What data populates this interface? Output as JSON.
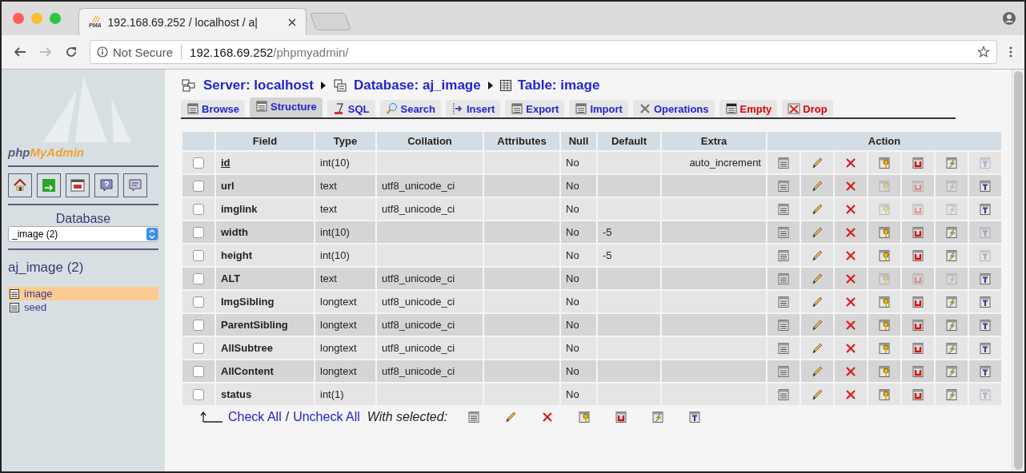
{
  "browser": {
    "tab": {
      "icon_text": "PMA",
      "title": "192.168.69.252 / localhost / a|"
    },
    "security": "Not Secure",
    "url_host": "192.168.69.252",
    "url_path": "/phpmyadmin/"
  },
  "sidebar": {
    "logo": {
      "part_1": "php",
      "part_2": "MyAdmin"
    },
    "database_label": "Database",
    "database_select": "_image (2)",
    "database_heading": "aj_image (2)",
    "tables": [
      {
        "name": "image",
        "selected": true
      },
      {
        "name": "seed",
        "selected": false
      }
    ]
  },
  "breadcrumb": [
    {
      "kind": "server",
      "label": "Server: localhost"
    },
    {
      "kind": "database",
      "label": "Database: aj_image"
    },
    {
      "kind": "table",
      "label": "Table: image"
    }
  ],
  "tabs": [
    {
      "kind": "browse",
      "label": "Browse",
      "selected": false,
      "danger": false
    },
    {
      "kind": "structure",
      "label": "Structure",
      "selected": true,
      "danger": false
    },
    {
      "kind": "sql",
      "label": "SQL",
      "selected": false,
      "danger": false
    },
    {
      "kind": "search",
      "label": "Search",
      "selected": false,
      "danger": false
    },
    {
      "kind": "insert",
      "label": "Insert",
      "selected": false,
      "danger": false
    },
    {
      "kind": "export",
      "label": "Export",
      "selected": false,
      "danger": false
    },
    {
      "kind": "import",
      "label": "Import",
      "selected": false,
      "danger": false
    },
    {
      "kind": "operations",
      "label": "Operations",
      "selected": false,
      "danger": false
    },
    {
      "kind": "empty",
      "label": "Empty",
      "selected": false,
      "danger": true
    },
    {
      "kind": "drop",
      "label": "Drop",
      "selected": false,
      "danger": true
    }
  ],
  "table": {
    "columns": [
      "Field",
      "Type",
      "Collation",
      "Attributes",
      "Null",
      "Default",
      "Extra",
      "Action"
    ],
    "rows": [
      {
        "field": "id",
        "primary": true,
        "checked": false,
        "type": "int(10)",
        "collation": "",
        "null": "No",
        "default": "",
        "extra": "auto_increment",
        "disabled": [
          false,
          false,
          false,
          false,
          false,
          false,
          true
        ]
      },
      {
        "field": "url",
        "primary": false,
        "checked": false,
        "type": "text",
        "collation": "utf8_unicode_ci",
        "null": "No",
        "default": "",
        "extra": "",
        "disabled": [
          false,
          false,
          false,
          true,
          true,
          true,
          false
        ]
      },
      {
        "field": "imglink",
        "primary": false,
        "checked": false,
        "type": "text",
        "collation": "utf8_unicode_ci",
        "null": "No",
        "default": "",
        "extra": "",
        "disabled": [
          false,
          false,
          false,
          true,
          true,
          true,
          false
        ]
      },
      {
        "field": "width",
        "primary": false,
        "checked": false,
        "type": "int(10)",
        "collation": "",
        "null": "No",
        "default": "-5",
        "extra": "",
        "disabled": [
          false,
          false,
          false,
          false,
          false,
          false,
          true
        ]
      },
      {
        "field": "height",
        "primary": false,
        "checked": false,
        "type": "int(10)",
        "collation": "",
        "null": "No",
        "default": "-5",
        "extra": "",
        "disabled": [
          false,
          false,
          false,
          false,
          false,
          false,
          true
        ]
      },
      {
        "field": "ALT",
        "primary": false,
        "checked": false,
        "type": "text",
        "collation": "utf8_unicode_ci",
        "null": "No",
        "default": "",
        "extra": "",
        "disabled": [
          false,
          false,
          false,
          true,
          true,
          true,
          false
        ]
      },
      {
        "field": "ImgSibling",
        "primary": false,
        "checked": false,
        "type": "longtext",
        "collation": "utf8_unicode_ci",
        "null": "No",
        "default": "",
        "extra": "",
        "disabled": [
          false,
          false,
          false,
          false,
          false,
          false,
          false
        ]
      },
      {
        "field": "ParentSibling",
        "primary": false,
        "checked": false,
        "type": "longtext",
        "collation": "utf8_unicode_ci",
        "null": "No",
        "default": "",
        "extra": "",
        "disabled": [
          false,
          false,
          false,
          false,
          false,
          false,
          false
        ]
      },
      {
        "field": "AllSubtree",
        "primary": false,
        "checked": false,
        "type": "longtext",
        "collation": "utf8_unicode_ci",
        "null": "No",
        "default": "",
        "extra": "",
        "disabled": [
          false,
          false,
          false,
          false,
          false,
          false,
          false
        ]
      },
      {
        "field": "AllContent",
        "primary": false,
        "checked": false,
        "type": "longtext",
        "collation": "utf8_unicode_ci",
        "null": "No",
        "default": "",
        "extra": "",
        "disabled": [
          false,
          false,
          false,
          false,
          false,
          false,
          false
        ]
      },
      {
        "field": "status",
        "primary": false,
        "checked": false,
        "type": "int(1)",
        "collation": "",
        "null": "No",
        "default": "",
        "extra": "",
        "disabled": [
          false,
          false,
          false,
          false,
          false,
          false,
          true
        ]
      }
    ]
  },
  "footer": {
    "check_all": "Check All",
    "separator": "/",
    "uncheck_all": "Uncheck All",
    "with_selected": "With selected:"
  }
}
